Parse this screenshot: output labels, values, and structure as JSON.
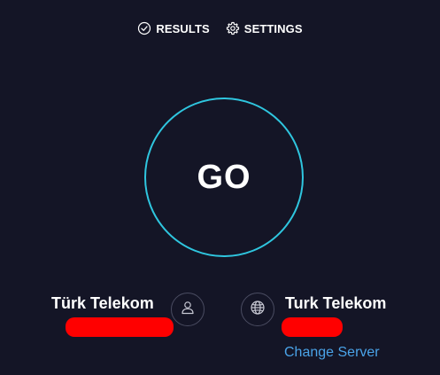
{
  "nav": {
    "results_label": "RESULTS",
    "settings_label": "SETTINGS"
  },
  "go_button": {
    "label": "GO"
  },
  "isp": {
    "name": "Türk Telekom"
  },
  "server": {
    "name": "Turk Telekom",
    "change_label": "Change Server"
  },
  "icons": {
    "results": "check-circle-icon",
    "settings": "gear-icon",
    "isp": "user-icon",
    "server": "globe-icon"
  },
  "colors": {
    "background": "#141526",
    "ring": "#2fc6df",
    "link": "#4aa3e8",
    "redaction": "#ff0000"
  }
}
